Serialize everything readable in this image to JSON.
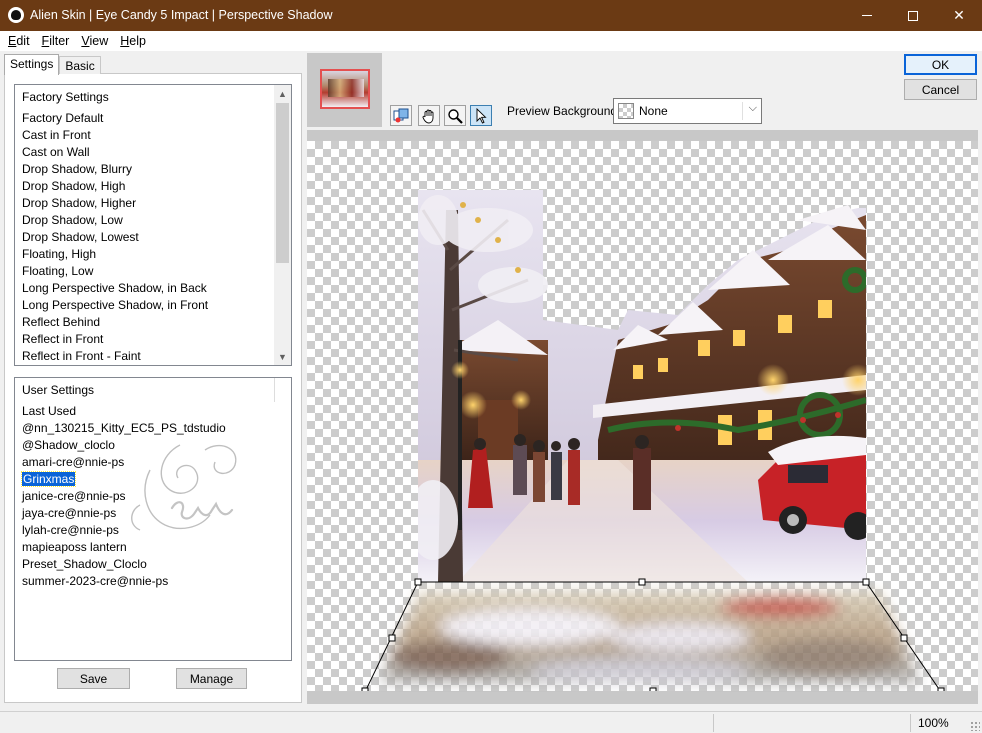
{
  "window": {
    "title": "Alien Skin | Eye Candy 5 Impact | Perspective Shadow"
  },
  "menu": [
    {
      "label": "Edit",
      "accel": "E",
      "rest": "dit"
    },
    {
      "label": "Filter",
      "accel": "F",
      "rest": "ilter"
    },
    {
      "label": "View",
      "accel": "V",
      "rest": "iew"
    },
    {
      "label": "Help",
      "accel": "H",
      "rest": "elp"
    }
  ],
  "tabs": {
    "settings": "Settings",
    "basic": "Basic"
  },
  "factory": {
    "header": "Factory Settings",
    "items": [
      "Factory Default",
      "Cast in Front",
      "Cast on Wall",
      "Drop Shadow, Blurry",
      "Drop Shadow, High",
      "Drop Shadow, Higher",
      "Drop Shadow, Low",
      "Drop Shadow, Lowest",
      "Floating, High",
      "Floating, Low",
      "Long Perspective Shadow, in Back",
      "Long Perspective Shadow, in Front",
      "Reflect Behind",
      "Reflect in Front",
      "Reflect in Front - Faint"
    ]
  },
  "user": {
    "header": "User Settings",
    "items": [
      "Last Used",
      "@nn_130215_Kitty_EC5_PS_tdstudio",
      "@Shadow_cloclo",
      "amari-cre@nnie-ps",
      "Grinxmas",
      "janice-cre@nnie-ps",
      "jaya-cre@nnie-ps",
      "lylah-cre@nnie-ps",
      "mapieaposs lantern",
      "Preset_Shadow_Cloclo",
      "summer-2023-cre@nnie-ps"
    ],
    "selected_index": 4
  },
  "buttons": {
    "save": "Save",
    "manage": "Manage",
    "ok": "OK",
    "cancel": "Cancel"
  },
  "preview_background": {
    "label": "Preview Background:",
    "value": "None"
  },
  "tools": [
    "preview-toggle-icon",
    "hand-icon",
    "zoom-icon",
    "arrow-pointer-icon"
  ],
  "status": {
    "zoom": "100%"
  },
  "colors": {
    "titlebar": "#6b3a14",
    "selection": "#0a64d8",
    "handle_stroke": "#000000"
  }
}
